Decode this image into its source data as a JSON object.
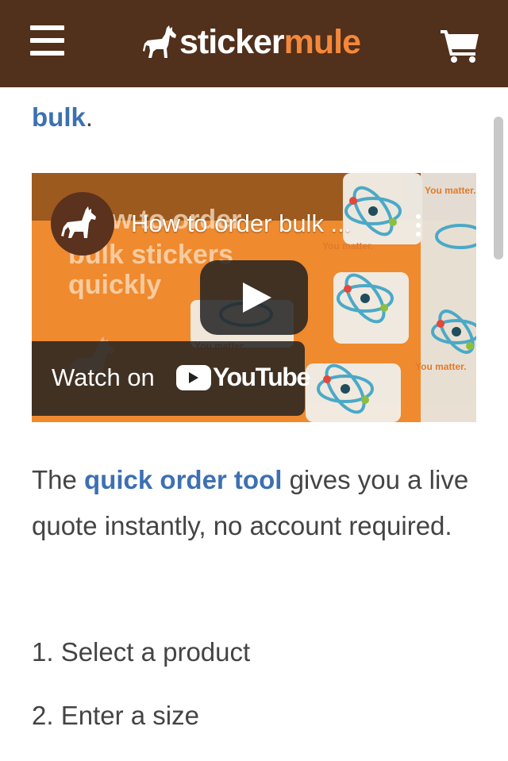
{
  "header": {
    "brand_part1": "sticker",
    "brand_part2": "mule",
    "brand_color": "#51301c",
    "accent_color": "#f4883a",
    "menu_icon": "hamburger-icon",
    "cart_icon": "cart-icon"
  },
  "intro": {
    "link_text": "bulk",
    "trailing": "."
  },
  "video": {
    "title": "How to order bulk ...",
    "thumbnail_text_line1": "w to order",
    "thumbnail_text_line2": "bulk stickers",
    "thumbnail_text_line3": "quickly",
    "sticker_text": "You matter.",
    "watch_label": "Watch on",
    "youtube_word": "YouTube",
    "play_icon": "play-icon",
    "more_icon": "kebab-icon"
  },
  "body": {
    "para_prefix": "The ",
    "para_link": "quick order tool",
    "para_suffix": " gives you a live quote instantly, no account required.",
    "link_color": "#3d70b2"
  },
  "steps": [
    {
      "label": "1. Select a product"
    },
    {
      "label": "2. Enter a size"
    }
  ]
}
